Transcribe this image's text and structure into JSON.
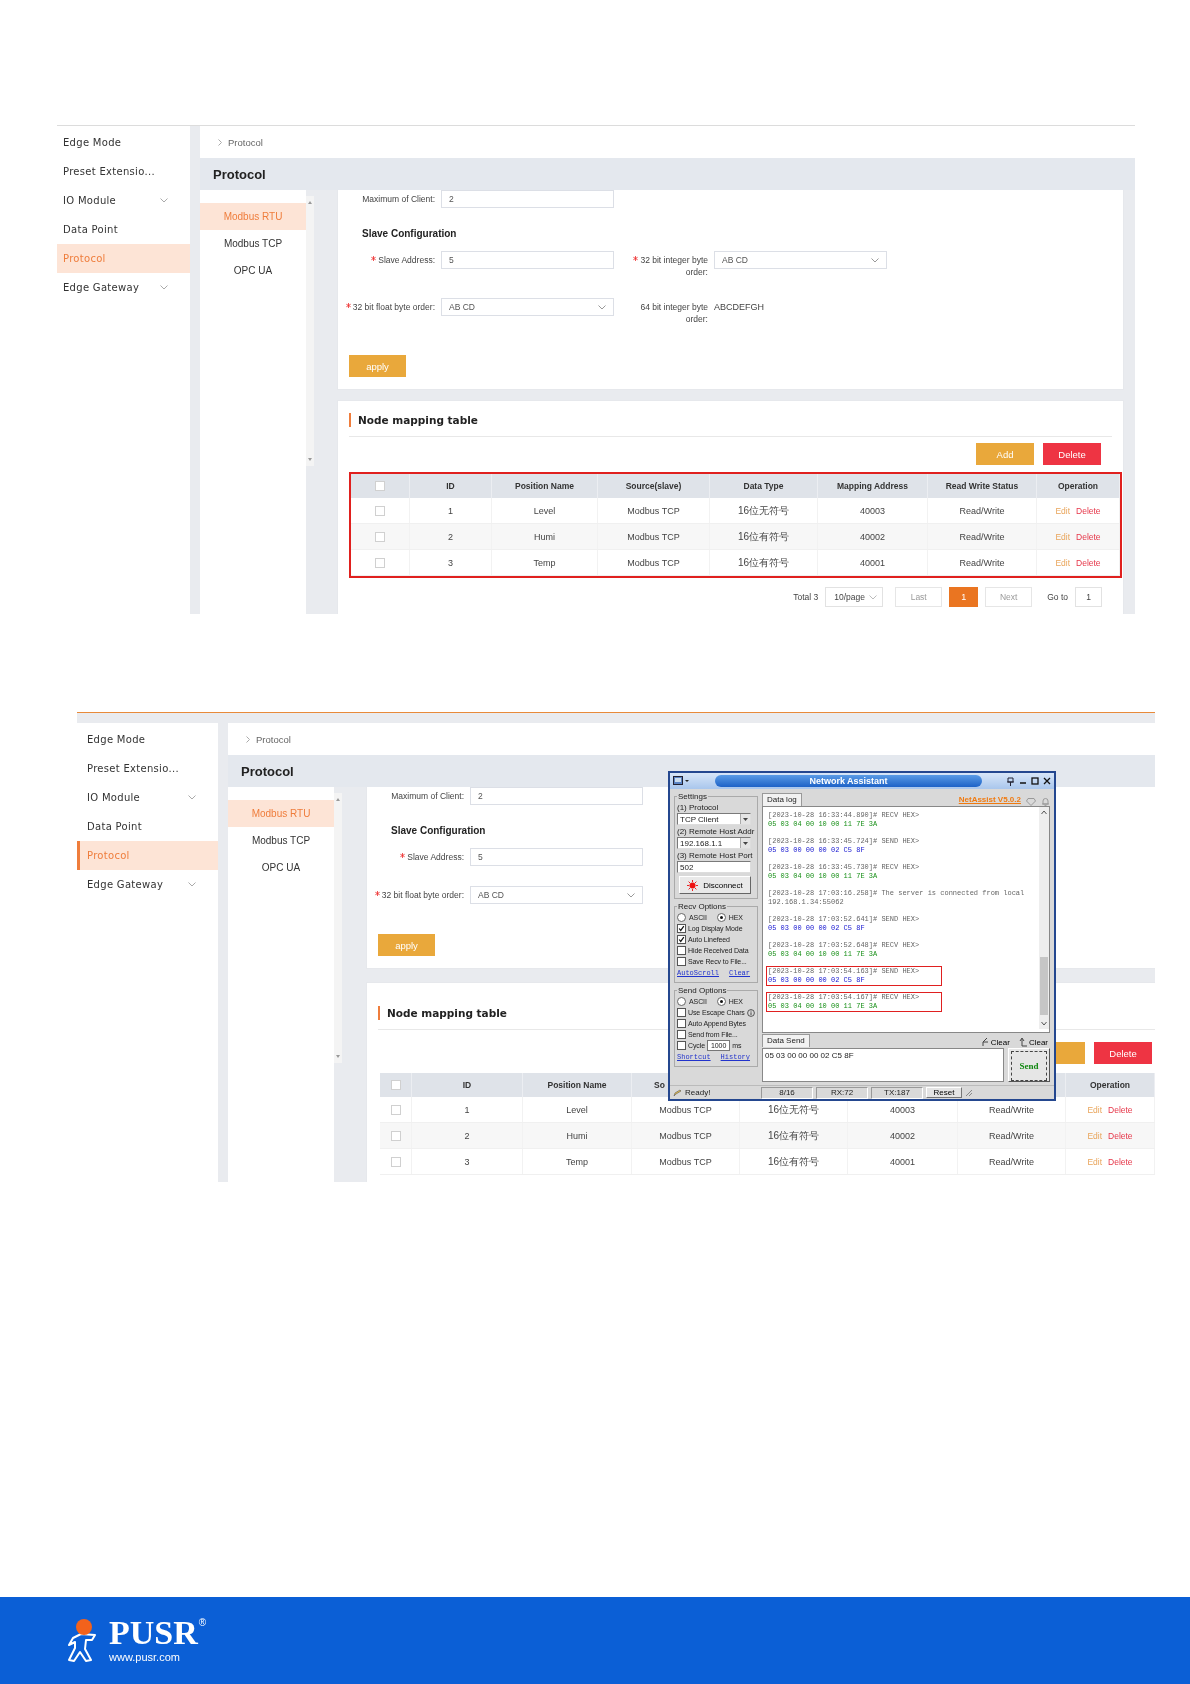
{
  "screenshots": [
    {
      "sidebar": {
        "items": [
          {
            "label": "Edge Mode",
            "selected": false,
            "has_submenu": false
          },
          {
            "label": "Preset Extensio...",
            "selected": false,
            "has_submenu": false
          },
          {
            "label": "IO Module",
            "selected": false,
            "has_submenu": true
          },
          {
            "label": "Data Point",
            "selected": false,
            "has_submenu": false
          },
          {
            "label": "Protocol",
            "selected": true,
            "has_submenu": false
          },
          {
            "label": "Edge Gateway",
            "selected": false,
            "has_submenu": true
          }
        ]
      },
      "breadcrumb": "Protocol",
      "title": "Protocol",
      "subnav": [
        {
          "label": "Modbus RTU",
          "selected": true
        },
        {
          "label": "Modbus TCP",
          "selected": false
        },
        {
          "label": "OPC UA",
          "selected": false
        }
      ],
      "form": {
        "rows": [
          {
            "kind": "fields",
            "fields": [
              {
                "label": "Maximum of Client:",
                "required": false,
                "kind": "input",
                "value": "2"
              }
            ]
          },
          {
            "kind": "heading",
            "text": "Slave Configuration"
          },
          {
            "kind": "fields",
            "fields": [
              {
                "label": "Slave Address:",
                "required": true,
                "kind": "input",
                "value": "5"
              },
              {
                "label": "32 bit integer byte order:",
                "required": true,
                "kind": "select",
                "value": "AB CD"
              }
            ]
          },
          {
            "kind": "fields",
            "fields": [
              {
                "label": "32 bit float byte order:",
                "required": true,
                "kind": "select",
                "value": "AB CD"
              },
              {
                "label": "64 bit integer byte order:",
                "required": false,
                "kind": "text",
                "value": "ABCDEFGH"
              }
            ]
          }
        ],
        "apply_button": "apply"
      },
      "node_table": {
        "title": "Node mapping table",
        "buttons": [
          {
            "kind": "add",
            "label": "Add"
          },
          {
            "kind": "delete",
            "label": "Delete"
          }
        ],
        "highlighted": true,
        "select_all_checked": false,
        "columns": [
          {
            "label": "ID"
          },
          {
            "label": "Position Name"
          },
          {
            "label": "Source(slave)"
          },
          {
            "label": "Data Type"
          },
          {
            "label": "Mapping Address"
          },
          {
            "label": "Read Write Status"
          },
          {
            "label": "Operation"
          }
        ],
        "rows": [
          {
            "checked": false,
            "cells": [
              "1",
              "Level",
              "Modbus TCP",
              "16位无符号",
              "40003",
              "Read/Write"
            ],
            "actions": [
              {
                "kind": "edit",
                "label": "Edit"
              },
              {
                "kind": "delete",
                "label": "Delete"
              }
            ]
          },
          {
            "checked": false,
            "cells": [
              "2",
              "Humi",
              "Modbus TCP",
              "16位有符号",
              "40002",
              "Read/Write"
            ],
            "actions": [
              {
                "kind": "edit",
                "label": "Edit"
              },
              {
                "kind": "delete",
                "label": "Delete"
              }
            ]
          },
          {
            "checked": false,
            "cells": [
              "3",
              "Temp",
              "Modbus TCP",
              "16位有符号",
              "40001",
              "Read/Write"
            ],
            "actions": [
              {
                "kind": "edit",
                "label": "Edit"
              },
              {
                "kind": "delete",
                "label": "Delete"
              }
            ]
          }
        ],
        "pagination": {
          "total": "Total 3",
          "page_size": "10/page",
          "prev": {
            "label": "Last",
            "disabled": true
          },
          "pages": [
            {
              "label": "1",
              "selected": true
            }
          ],
          "next": {
            "label": "Next",
            "disabled": true
          },
          "goto_label": "Go to",
          "goto_value": "1"
        }
      }
    },
    {
      "sidebar": {
        "items": [
          {
            "label": "Edge Mode",
            "selected": false,
            "has_submenu": false
          },
          {
            "label": "Preset Extensio...",
            "selected": false,
            "has_submenu": false
          },
          {
            "label": "IO Module",
            "selected": false,
            "has_submenu": true
          },
          {
            "label": "Data Point",
            "selected": false,
            "has_submenu": false
          },
          {
            "label": "Protocol",
            "selected": true,
            "has_submenu": false
          },
          {
            "label": "Edge Gateway",
            "selected": false,
            "has_submenu": true
          }
        ]
      },
      "breadcrumb": "Protocol",
      "title": "Protocol",
      "subnav": [
        {
          "label": "Modbus RTU",
          "selected": true
        },
        {
          "label": "Modbus TCP",
          "selected": false
        },
        {
          "label": "OPC UA",
          "selected": false
        }
      ],
      "form": {
        "rows": [
          {
            "kind": "fields",
            "fields": [
              {
                "label": "Maximum of Client:",
                "required": false,
                "kind": "input",
                "value": "2"
              }
            ]
          },
          {
            "kind": "heading",
            "text": "Slave Configuration"
          },
          {
            "kind": "fields",
            "fields": [
              {
                "label": "Slave Address:",
                "required": true,
                "kind": "input",
                "value": "5"
              }
            ]
          },
          {
            "kind": "fields",
            "fields": [
              {
                "label": "32 bit float byte order:",
                "required": true,
                "kind": "select",
                "value": "AB CD"
              }
            ]
          }
        ],
        "apply_button": "apply"
      },
      "node_table": {
        "title": "Node mapping table",
        "buttons": [
          {
            "kind": "add"
          },
          {
            "kind": "delete",
            "label": "Delete"
          }
        ],
        "highlighted": false,
        "select_all_checked": false,
        "columns": [
          {
            "label": "ID"
          },
          {
            "label": "Position Name"
          },
          {
            "label": "So"
          },
          {},
          {},
          {},
          {
            "label": "Operation"
          }
        ],
        "rows": [
          {
            "checked": false,
            "cells": [
              "1",
              "Level",
              "Modbus TCP",
              "16位无符号",
              "40003",
              "Read/Write"
            ],
            "actions": [
              {
                "kind": "edit",
                "label": "Edit"
              },
              {
                "kind": "delete",
                "label": "Delete"
              }
            ]
          },
          {
            "checked": false,
            "cells": [
              "2",
              "Humi",
              "Modbus TCP",
              "16位有符号",
              "40002",
              "Read/Write"
            ],
            "actions": [
              {
                "kind": "edit",
                "label": "Edit"
              },
              {
                "kind": "delete",
                "label": "Delete"
              }
            ]
          },
          {
            "checked": false,
            "cells": [
              "3",
              "Temp",
              "Modbus TCP",
              "16位有符号",
              "40001",
              "Read/Write"
            ],
            "actions": [
              {
                "kind": "edit",
                "label": "Edit"
              },
              {
                "kind": "delete",
                "label": "Delete"
              }
            ]
          }
        ]
      }
    }
  ],
  "network_assistant": {
    "title": "Network Assistant",
    "settings": {
      "legend": "Settings",
      "fields": [
        {
          "label": "(1) Protocol",
          "kind": "select",
          "value": "TCP Client"
        },
        {
          "label": "(2) Remote Host Addr",
          "kind": "select",
          "value": "192.168.1.1"
        },
        {
          "label": "(3) Remote Host Port",
          "kind": "input",
          "value": "502"
        }
      ],
      "connect_button": "Disconnect"
    },
    "recv_options": {
      "legend": "Recv Options",
      "modes": [
        {
          "label": "ASCII",
          "selected": false
        },
        {
          "label": "HEX",
          "selected": true
        }
      ],
      "options": [
        {
          "label": "Log Display Mode",
          "checked": true
        },
        {
          "label": "Auto Linefeed",
          "checked": true
        },
        {
          "label": "Hide Received Data",
          "checked": false
        },
        {
          "label": "Save Recv to File...",
          "checked": false
        }
      ],
      "links": [
        "AutoScroll",
        "Clear"
      ]
    },
    "send_options": {
      "legend": "Send Options",
      "modes": [
        {
          "label": "ASCII",
          "selected": false
        },
        {
          "label": "HEX",
          "selected": true
        }
      ],
      "options": [
        {
          "label": "Use Escape Chars",
          "checked": false,
          "info": true
        },
        {
          "label": "Auto Append Bytes",
          "checked": false
        },
        {
          "label": "Send from File...",
          "checked": false
        },
        {
          "label": "Cycle",
          "checked": false,
          "value": "1000",
          "unit": "ms"
        }
      ],
      "links": [
        "Shortcut",
        "History"
      ]
    },
    "log_tab": "Data log",
    "version_link": "NetAssist V5.0.2",
    "log": [
      {
        "kind": "recv",
        "header": "[2023-10-28 16:33:44.890]# RECV HEX>",
        "data": "05 03 04 00 10 00 11 7E 3A",
        "highlighted": false
      },
      {
        "kind": "send",
        "header": "[2023-10-28 16:33:45.724]# SEND HEX>",
        "data": "05 03 00 00 00 02 C5 8F",
        "highlighted": false
      },
      {
        "kind": "recv",
        "header": "[2023-10-28 16:33:45.730]# RECV HEX>",
        "data": "05 03 04 00 10 00 11 7E 3A",
        "highlighted": false
      },
      {
        "kind": "info",
        "text": "[2023-10-28 17:03:16.258]# The server is connected from local 192.168.1.34:55062",
        "highlighted": false
      },
      {
        "kind": "send",
        "header": "[2023-10-28 17:03:52.641]# SEND HEX>",
        "data": "05 03 00 00 00 02 C5 8F",
        "highlighted": false
      },
      {
        "kind": "recv",
        "header": "[2023-10-28 17:03:52.648]# RECV HEX>",
        "data": "05 03 04 00 10 00 11 7E 3A",
        "highlighted": false
      },
      {
        "kind": "send",
        "header": "[2023-10-28 17:03:54.163]# SEND HEX>",
        "data": "05 03 00 00 00 02 C5 8F",
        "highlighted": true
      },
      {
        "kind": "recv",
        "header": "[2023-10-28 17:03:54.167]# RECV HEX>",
        "data": "05 03 04 00 10 00 11 7E 3A",
        "highlighted": true
      }
    ],
    "send_tab": "Data Send",
    "clear_buttons": [
      "Clear",
      "Clear"
    ],
    "send_text": "05 03 00 00 00 02 C5 8F",
    "send_button": "Send",
    "status": {
      "message": "Ready!",
      "counters": [
        "8/16",
        "RX:72",
        "TX:187"
      ],
      "reset_button": "Reset"
    }
  },
  "footer": {
    "brand": "PUSR",
    "registered": "®",
    "website": "www.pusr.com"
  }
}
